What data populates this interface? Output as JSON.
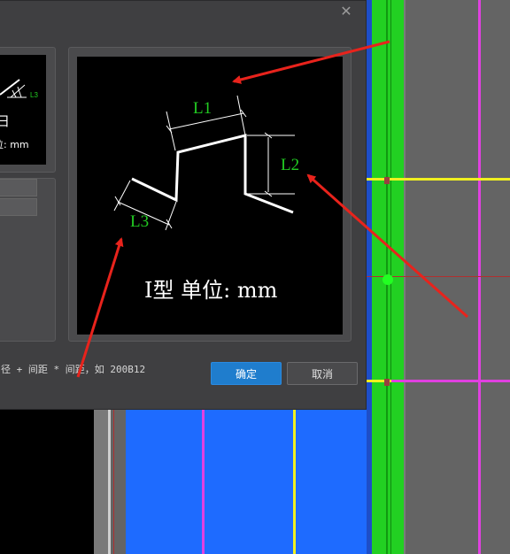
{
  "dialog": {
    "close_glyph": "✕",
    "hint_text": "径 + 间距 * 间距，如 200B12",
    "ok_label": "确定",
    "cancel_label": "取消"
  },
  "left_preview": {
    "label_l3": "L3",
    "fragment_char": "日",
    "unit_fragment": "单位: mm"
  },
  "main_preview": {
    "label_l1": "L1",
    "label_l2": "L2",
    "label_l3": "L3",
    "caption": "I型 单位: mm"
  },
  "colors": {
    "dialog_bg": "#3f3f41",
    "ok_button": "#1f7dcd",
    "dimension_text": "#22cc22",
    "arrow": "#e8231c",
    "cad_blue": "#1e6bff",
    "cad_green": "#22d022",
    "cad_magenta": "#e040e0",
    "cad_yellow": "#f0f020"
  }
}
